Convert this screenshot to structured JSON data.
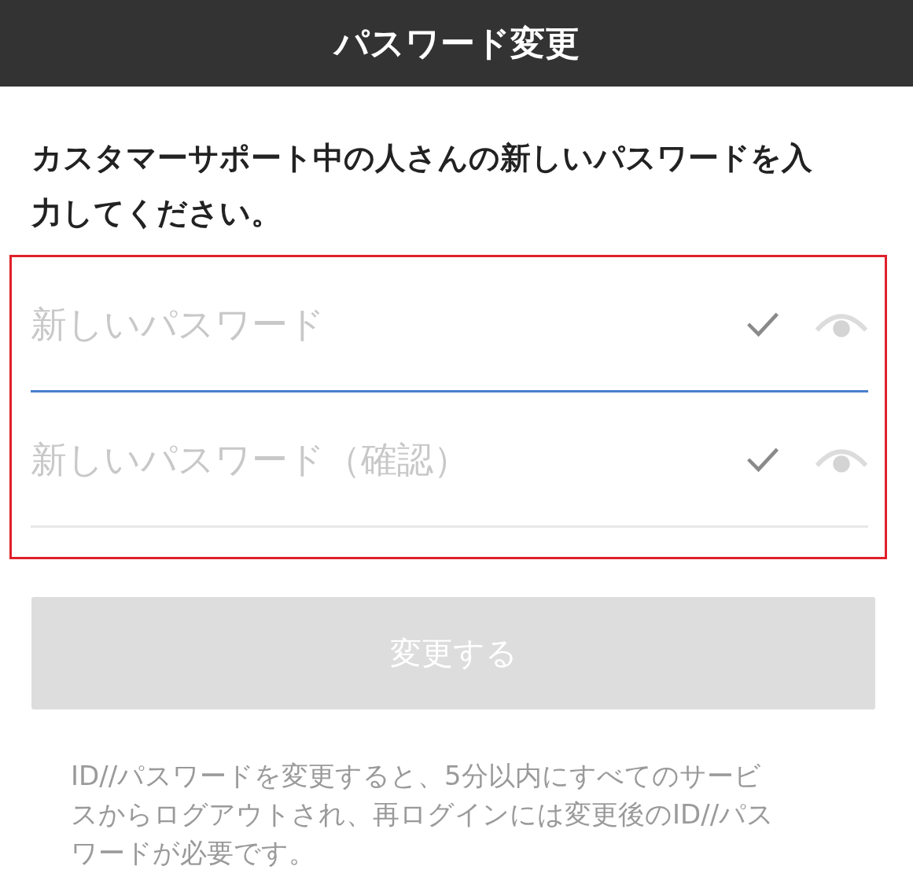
{
  "header": {
    "title": "パスワード変更"
  },
  "instruction": "カスタマーサポート中の人さんの新しいパスワードを入力してください。",
  "fields": [
    {
      "placeholder": "新しいパスワード",
      "focused": true
    },
    {
      "placeholder": "新しいパスワード（確認）",
      "focused": false
    }
  ],
  "submit_button": {
    "label": "変更する",
    "disabled": true
  },
  "note": "ID//パスワードを変更すると、5分以内にすべてのサービスからログアウトされ、再ログインには変更後のID//パスワードが必要です。"
}
